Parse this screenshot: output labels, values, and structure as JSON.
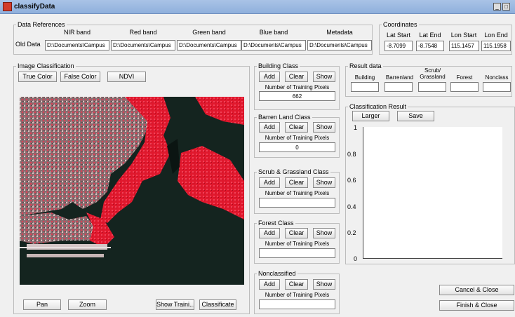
{
  "window": {
    "title": "classifyData",
    "min_label": "_",
    "max_label": "□"
  },
  "data_references": {
    "title": "Data References",
    "row_label": "Old Data",
    "columns": [
      "NIR band",
      "Red band",
      "Green band",
      "Blue band",
      "Metadata"
    ],
    "values": [
      "D:\\Documents\\Campus",
      "D:\\Documents\\Campus",
      "D:\\Documents\\Campus",
      "D:\\Documents\\Campus",
      "D:\\Documents\\Campus"
    ]
  },
  "coordinates": {
    "title": "Coordinates",
    "columns": [
      "Lat Start",
      "Lat End",
      "Lon Start",
      "Lon End"
    ],
    "values": [
      "-8.7099",
      "-8.7548",
      "115.1457",
      "115.1958"
    ]
  },
  "image_classification": {
    "title": "Image Classification",
    "buttons": {
      "true_color": "True Color",
      "false_color": "False Color",
      "ndvi": "NDVI",
      "pan": "Pan",
      "zoom": "Zoom",
      "show_training": "Show Traini...",
      "classificate": "Classificate"
    }
  },
  "classes": [
    {
      "title": "Building Class",
      "add": "Add",
      "clear": "Clear",
      "show": "Show",
      "pixels_label": "Number of Training Pixels",
      "pixels": "662"
    },
    {
      "title": "Barren Land Class",
      "add": "Add",
      "clear": "Clear",
      "show": "Show",
      "pixels_label": "Number of Training Pixels",
      "pixels": "0"
    },
    {
      "title": "Scrub & Grassland Class",
      "add": "Add",
      "clear": "Clear",
      "show": "Show",
      "pixels_label": "Number of Training Pixels",
      "pixels": ""
    },
    {
      "title": "Forest Class",
      "add": "Add",
      "clear": "Clear",
      "show": "Show",
      "pixels_label": "Number of Training Pixels",
      "pixels": ""
    },
    {
      "title": "Nonclassified",
      "add": "Add",
      "clear": "Clear",
      "show": "Show",
      "pixels_label": "Number of Training Pixels",
      "pixels": ""
    }
  ],
  "result_data": {
    "title": "Result data",
    "columns": [
      "Building",
      "Barrenland",
      "Scrub/\nGrassland",
      "Forest",
      "Nonclass"
    ],
    "values": [
      "",
      "",
      "",
      "",
      ""
    ]
  },
  "classification_result": {
    "title": "Classification Result",
    "larger": "Larger",
    "save": "Save",
    "yticks": [
      "1",
      "0.8",
      "0.6",
      "0.4",
      "0.2",
      "0"
    ]
  },
  "footer": {
    "cancel": "Cancel & Close",
    "finish": "Finish & Close"
  }
}
